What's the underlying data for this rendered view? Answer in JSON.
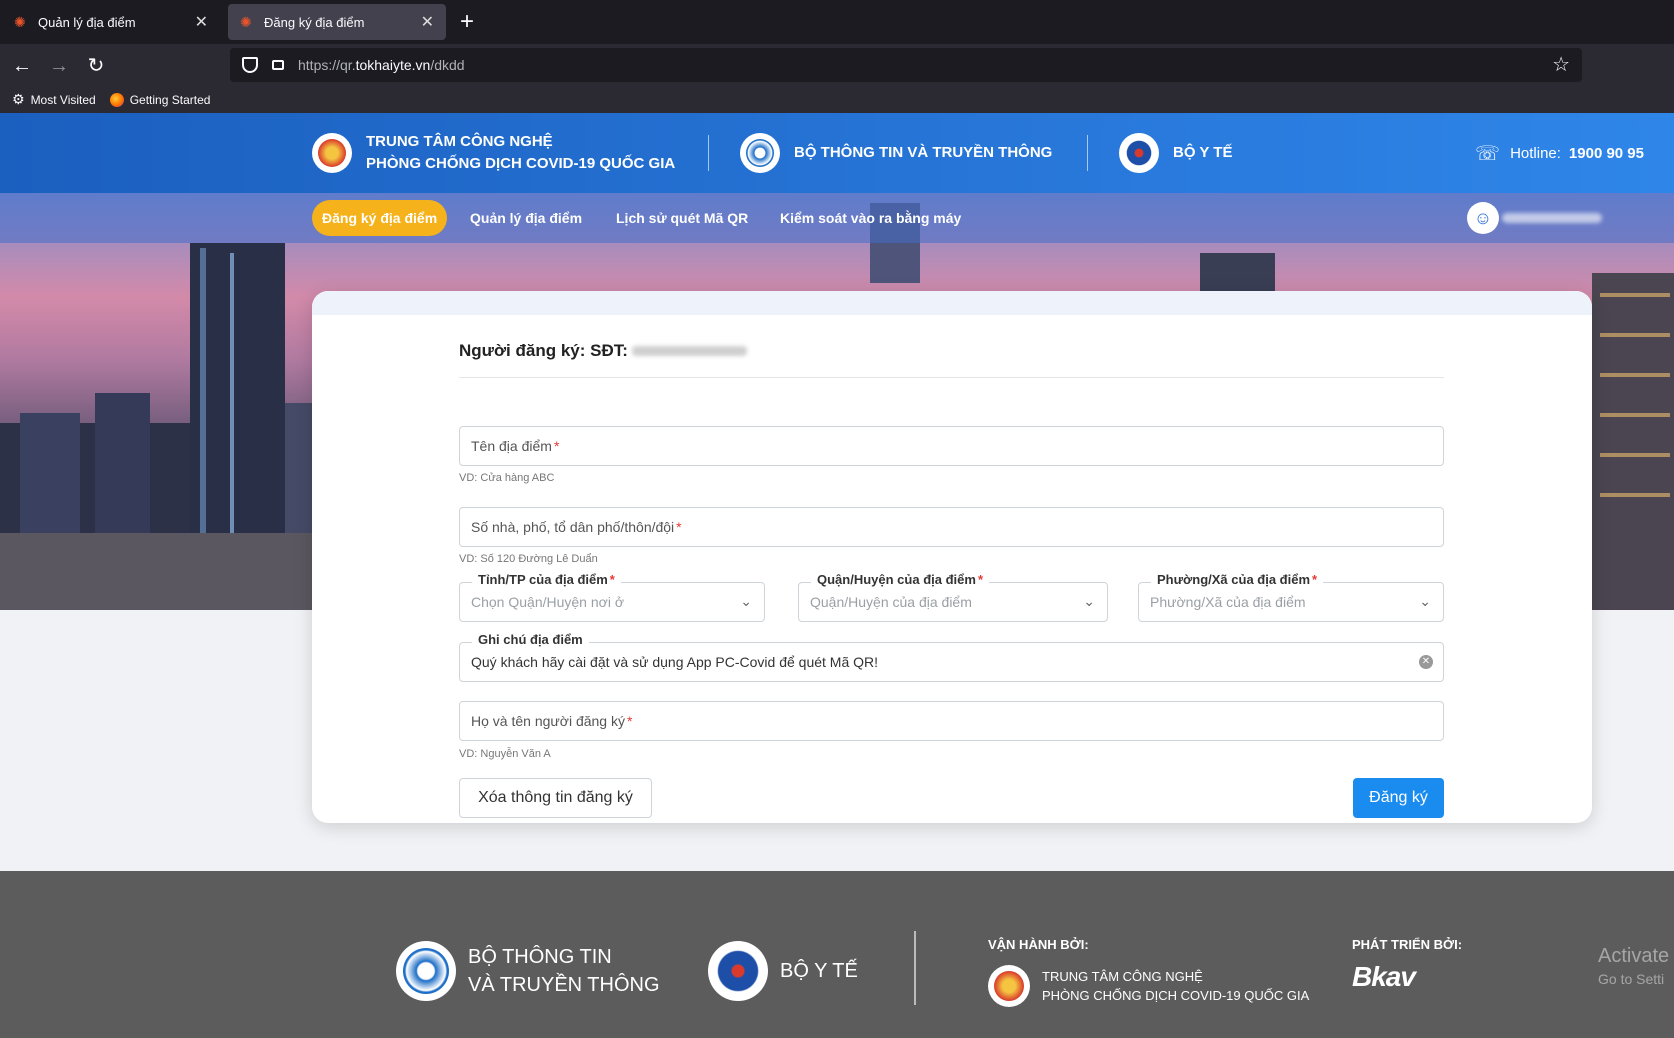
{
  "browser": {
    "tabs": [
      {
        "title": "Quản lý địa điểm",
        "active": false
      },
      {
        "title": "Đăng ký địa điểm",
        "active": true
      }
    ],
    "url_prefix": "https://qr.",
    "url_domain": "tokhaiyte.vn",
    "url_path": "/dkdd",
    "bookmarks": [
      "Most Visited",
      "Getting Started"
    ]
  },
  "header": {
    "org1_line1": "TRUNG TÂM CÔNG NGHỆ",
    "org1_line2": "PHÒNG CHỐNG DỊCH COVID-19 QUỐC GIA",
    "org2": "BỘ THÔNG TIN VÀ TRUYỀN THÔNG",
    "org3": "BỘ Y TẾ",
    "hotline_label": "Hotline:",
    "hotline_number": "1900 90 95"
  },
  "nav": {
    "items": [
      "Đăng ký địa điểm",
      "Quản lý địa điểm",
      "Lịch sử quét Mã QR",
      "Kiểm soát vào ra bằng máy"
    ],
    "active_index": 0
  },
  "form": {
    "registrant_label": "Người đăng ký: SĐT:",
    "name_placeholder": "Tên địa điểm",
    "name_hint": "VD: Cửa hàng ABC",
    "address_placeholder": "Số nhà, phố, tổ dân phố/thôn/đội",
    "address_hint": "VD: Số 120 Đường Lê Duẩn",
    "province_label": "Tỉnh/TP của địa điểm",
    "province_placeholder": "Chọn Quận/Huyện nơi ở",
    "district_label": "Quận/Huyện của địa điểm",
    "district_placeholder": "Quận/Huyện của địa điểm",
    "ward_label": "Phường/Xã của địa điểm",
    "ward_placeholder": "Phường/Xã của địa điểm",
    "note_label": "Ghi chú địa điểm",
    "note_value": "Quý khách hãy cài đặt và sử dụng App PC-Covid để quét Mã QR!",
    "fullname_placeholder": "Họ và tên người đăng ký",
    "fullname_hint": "VD: Nguyễn Văn A",
    "required_mark": "*",
    "clear_button": "Xóa thông tin đăng ký",
    "submit_button": "Đăng ký"
  },
  "footer": {
    "mic_line1": "BỘ THÔNG TIN",
    "mic_line2": "VÀ TRUYỀN THÔNG",
    "moh": "BỘ Y TẾ",
    "operated_by": "VẬN HÀNH BỞI:",
    "operator_line1": "TRUNG TÂM CÔNG NGHỆ",
    "operator_line2": "PHÒNG CHỐNG DỊCH COVID-19 QUỐC GIA",
    "developed_by": "PHÁT TRIỂN BỞI:",
    "developer": "Bkav",
    "watermark_line1": "Activate",
    "watermark_line2": "Go to Setti"
  },
  "colors": {
    "header_blue": "#1b5fbf",
    "nav_active": "#f6b21b",
    "submit_blue": "#1a8cf0",
    "required_red": "#e53935",
    "footer_gray": "#5c5c5c"
  }
}
